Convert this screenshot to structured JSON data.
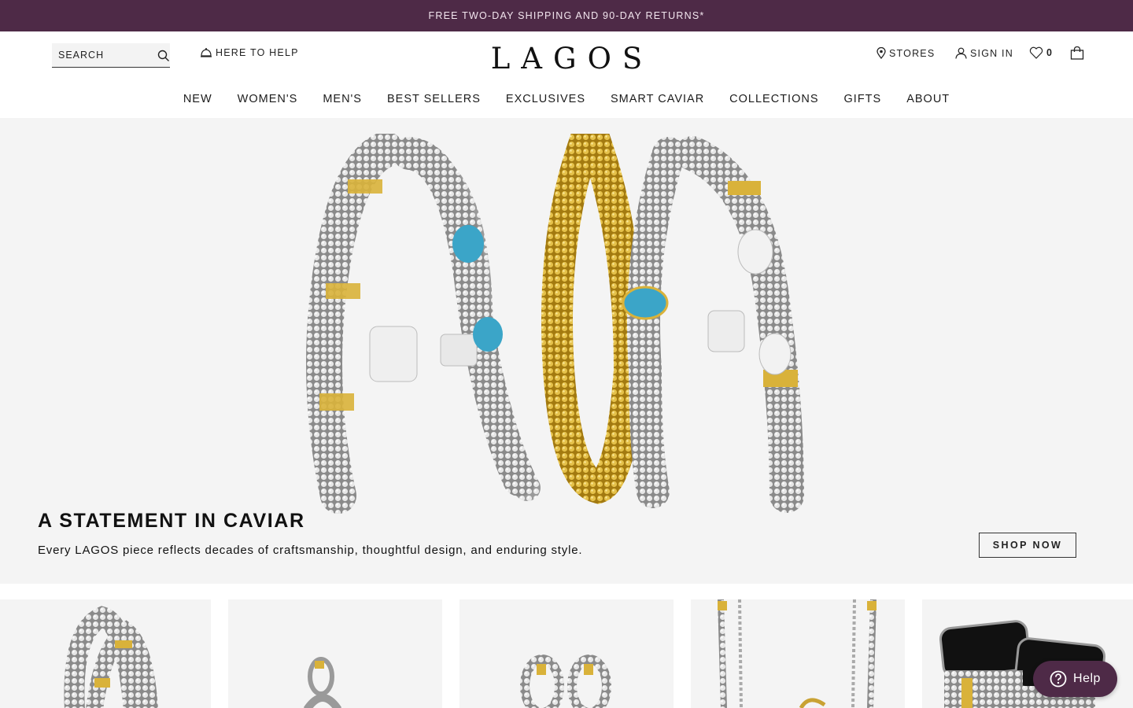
{
  "promo": {
    "text": "FREE TWO-DAY SHIPPING AND 90-DAY RETURNS*"
  },
  "header": {
    "search_placeholder": "SEARCH",
    "help_label": "HERE TO HELP",
    "logo": "LAGOS",
    "stores_label": "STORES",
    "signin_label": "SIGN IN",
    "wishlist_count": "0"
  },
  "nav": [
    "NEW",
    "WOMEN'S",
    "MEN'S",
    "BEST SELLERS",
    "EXCLUSIVES",
    "SMART CAVIAR",
    "COLLECTIONS",
    "GIFTS",
    "ABOUT"
  ],
  "hero": {
    "title": "A STATEMENT IN CAVIAR",
    "subtitle": "Every LAGOS piece reflects decades of craftsmanship, thoughtful design, and enduring style.",
    "cta": "SHOP NOW"
  },
  "help_widget": {
    "label": "Help"
  },
  "colors": {
    "brand": "#4e2a47",
    "gold": "#d9b23a",
    "silver": "#b9b9b9",
    "topaz": "#3ba5c8"
  },
  "icons": [
    "search-icon",
    "bell-icon",
    "map-pin-icon",
    "user-icon",
    "heart-icon",
    "bag-icon",
    "question-icon"
  ]
}
